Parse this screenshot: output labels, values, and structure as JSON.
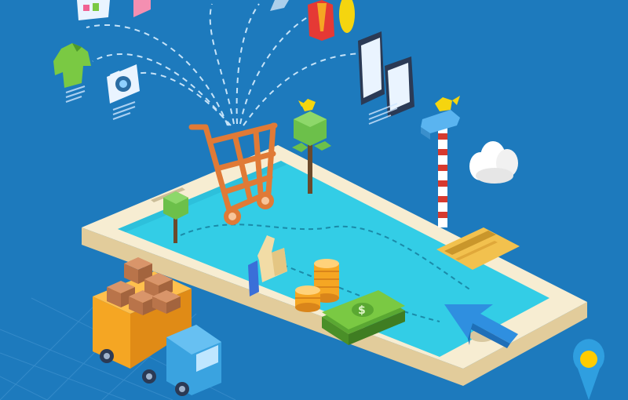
{
  "scene": {
    "description_free": true,
    "colors": {
      "background": "#1f7fc4",
      "background_dark": "#17679f",
      "phone_body": "#f7edd2",
      "phone_side": "#e3cfa0",
      "screen": "#33cde6",
      "screen_dark": "#1fa9c4",
      "cart": "#e07a36",
      "truck_box": "#f5a623",
      "truck_cab": "#3aa3e0",
      "money": "#7ac943",
      "coins": "#f5a623",
      "card": "#f2c14e",
      "cursor": "#2f8fe0",
      "tree_green": "#6cc04a",
      "tree_trunk": "#6b4a2b",
      "pole_red": "#d63a2f",
      "map_pin": "#2f9fe0",
      "pin_center": "#ffcc00"
    },
    "icons": [
      "monitor-icon",
      "tshirt-icon",
      "camera-icon",
      "shirt-icon",
      "tablet-icon",
      "phone-icon",
      "shopping-cart-icon",
      "thumbs-up-icon",
      "coin-stack-icon",
      "money-bill-icon",
      "credit-card-icon",
      "cursor-arrow-icon",
      "delivery-truck-icon",
      "boxes-icon",
      "map-pin-icon",
      "cloud-icon",
      "tree-icon",
      "bird-icon",
      "signpost-icon"
    ]
  }
}
